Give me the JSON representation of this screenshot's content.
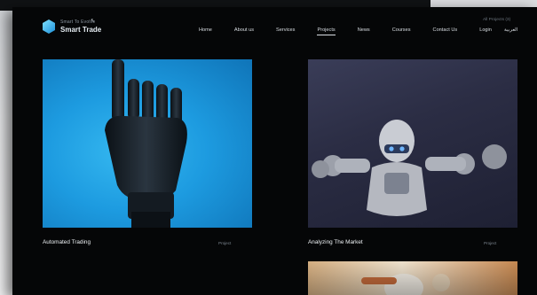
{
  "brand": {
    "tagline": "Smart To Evolve",
    "name": "Smart Trade"
  },
  "nav": {
    "items": [
      {
        "label": "Home"
      },
      {
        "label": "About us"
      },
      {
        "label": "Services"
      },
      {
        "label": "Projects",
        "active": true
      },
      {
        "label": "News"
      },
      {
        "label": "Courses"
      },
      {
        "label": "Contact Us"
      },
      {
        "label": "Login"
      }
    ],
    "language": "العربية",
    "all_projects": "All Projects (3)"
  },
  "projects": [
    {
      "title": "Automated Trading",
      "tag": "Project",
      "image": "robotic-hand-image"
    },
    {
      "title": "Analyzing The Market",
      "tag": "Project",
      "image": "robot-figure-image"
    },
    {
      "title": "",
      "tag": "",
      "image": "robot-figure-warm-image"
    }
  ],
  "colors": {
    "page_bg": "#050607",
    "hand_bg": "#1d9be0",
    "robot_bg": "#2b2d44",
    "logo_accent": "#1d8fd8"
  }
}
